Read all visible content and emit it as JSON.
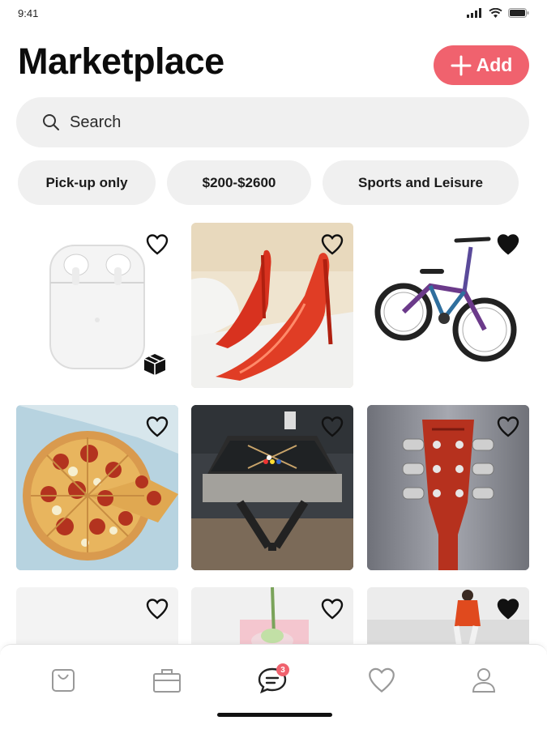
{
  "status_bar": {
    "time": "9:41"
  },
  "header": {
    "title": "Marketplace",
    "add_label": "Add"
  },
  "search": {
    "placeholder": "Search"
  },
  "filters": [
    "Pick-up only",
    "$200-$2600",
    "Sports and Leisure"
  ],
  "listings": [
    {
      "item": "airpods",
      "favorited": false,
      "shipping_badge": true
    },
    {
      "item": "red-high-heels",
      "favorited": false
    },
    {
      "item": "bmx-bike",
      "favorited": true
    },
    {
      "item": "pizza",
      "favorited": false
    },
    {
      "item": "pool-table",
      "favorited": false
    },
    {
      "item": "guitar-headstock",
      "favorited": false
    },
    {
      "item": "blank",
      "favorited": false
    },
    {
      "item": "flower",
      "favorited": false
    },
    {
      "item": "person-red-sweater",
      "favorited": true
    }
  ],
  "bottom_nav": {
    "items": [
      "shopping-bag-icon",
      "briefcase-icon",
      "chat-icon",
      "heart-icon",
      "profile-icon"
    ],
    "chat_badge": "3"
  },
  "colors": {
    "accent": "#f0626e",
    "chip_bg": "#f0f0f0"
  }
}
